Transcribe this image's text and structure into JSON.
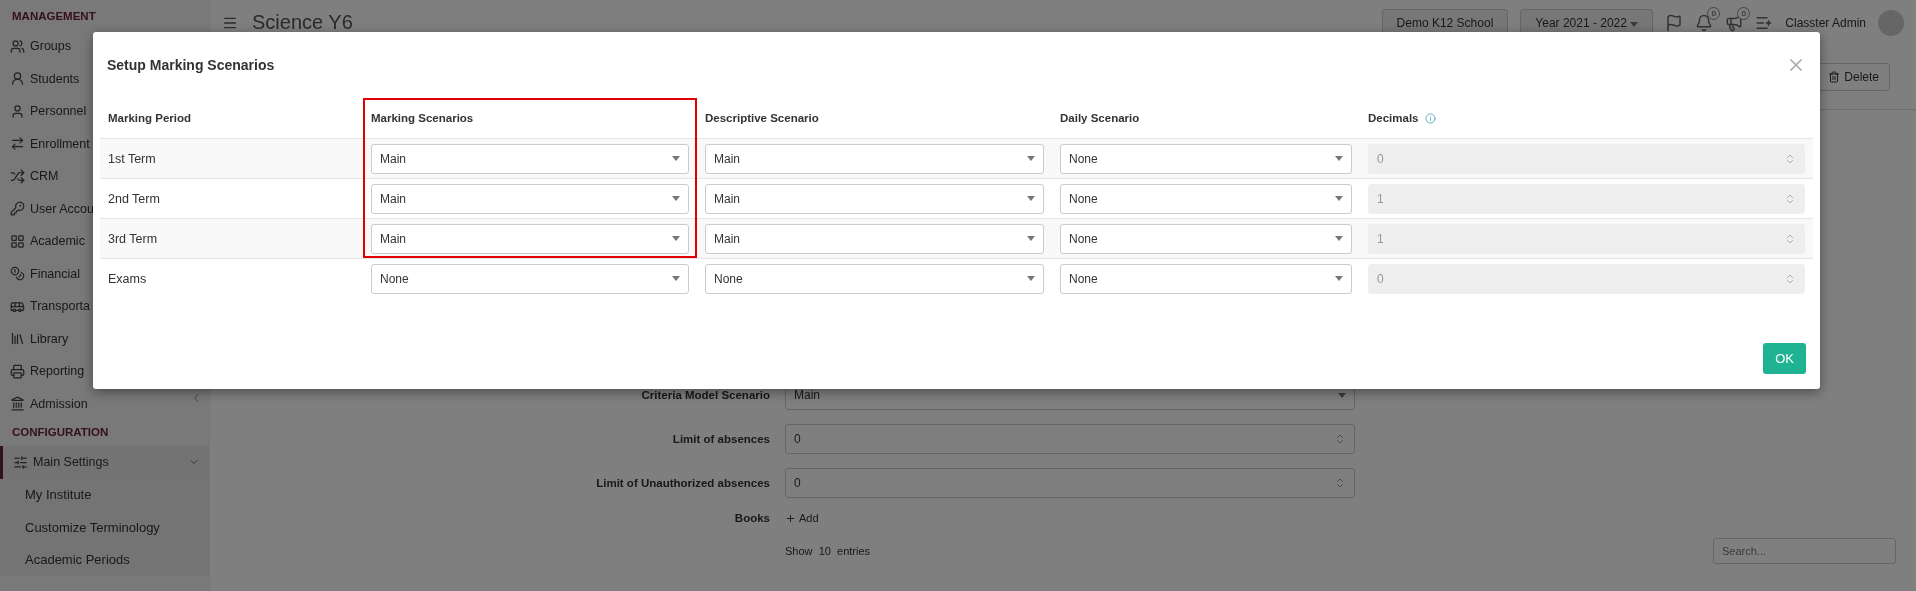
{
  "sidebar": {
    "sections": [
      {
        "title": "MANAGEMENT",
        "items": [
          {
            "label": "Groups"
          },
          {
            "label": "Students"
          },
          {
            "label": "Personnel"
          },
          {
            "label": "Enrollment"
          },
          {
            "label": "CRM"
          },
          {
            "label": "User Accou"
          },
          {
            "label": "Academic"
          },
          {
            "label": "Financial"
          },
          {
            "label": "Transporta"
          },
          {
            "label": "Library"
          },
          {
            "label": "Reporting"
          },
          {
            "label": "Admission"
          }
        ]
      },
      {
        "title": "CONFIGURATION",
        "items": [
          {
            "label": "Main Settings",
            "expanded": true,
            "children": [
              {
                "label": "My Institute"
              },
              {
                "label": "Customize Terminology"
              },
              {
                "label": "Academic Periods"
              }
            ]
          }
        ]
      }
    ]
  },
  "header": {
    "title": "Science Y6",
    "school": "Demo K12 School",
    "year": "Year 2021 - 2022",
    "badges": [
      "0",
      "0"
    ],
    "user": "Classter Admin"
  },
  "actions": {
    "delete": "Delete"
  },
  "form": {
    "fields": [
      {
        "label": "Criteria Model Scenario",
        "value": "Main",
        "kind": "select"
      },
      {
        "label": "Limit of absences",
        "value": "0",
        "kind": "number"
      },
      {
        "label": "Limit of Unauthorized absences",
        "value": "0",
        "kind": "number"
      }
    ],
    "books": {
      "label": "Books",
      "add": "Add"
    },
    "table_controls": {
      "show": "Show",
      "count": "10",
      "entries": "entries",
      "search_placeholder": "Search..."
    }
  },
  "modal": {
    "title": "Setup Marking Scenarios",
    "ok": "OK",
    "columns": [
      {
        "label": "Marking Period",
        "highlighted": false
      },
      {
        "label": "Marking Scenarios",
        "highlighted": true
      },
      {
        "label": "Descriptive Scenario",
        "highlighted": false
      },
      {
        "label": "Daily Scenario",
        "highlighted": false
      },
      {
        "label": "Decimals",
        "highlighted": false,
        "info": true
      }
    ],
    "rows": [
      {
        "period": "1st Term",
        "marking": "Main",
        "descriptive": "Main",
        "daily": "None",
        "decimals": "0",
        "disabled": true,
        "highlighted": true
      },
      {
        "period": "2nd Term",
        "marking": "Main",
        "descriptive": "Main",
        "daily": "None",
        "decimals": "1",
        "disabled": true,
        "highlighted": true
      },
      {
        "period": "3rd Term",
        "marking": "Main",
        "descriptive": "Main",
        "daily": "None",
        "decimals": "1",
        "disabled": true,
        "highlighted": true
      },
      {
        "period": "Exams",
        "marking": "None",
        "descriptive": "None",
        "daily": "None",
        "decimals": "0",
        "disabled": true,
        "highlighted": false
      }
    ]
  }
}
